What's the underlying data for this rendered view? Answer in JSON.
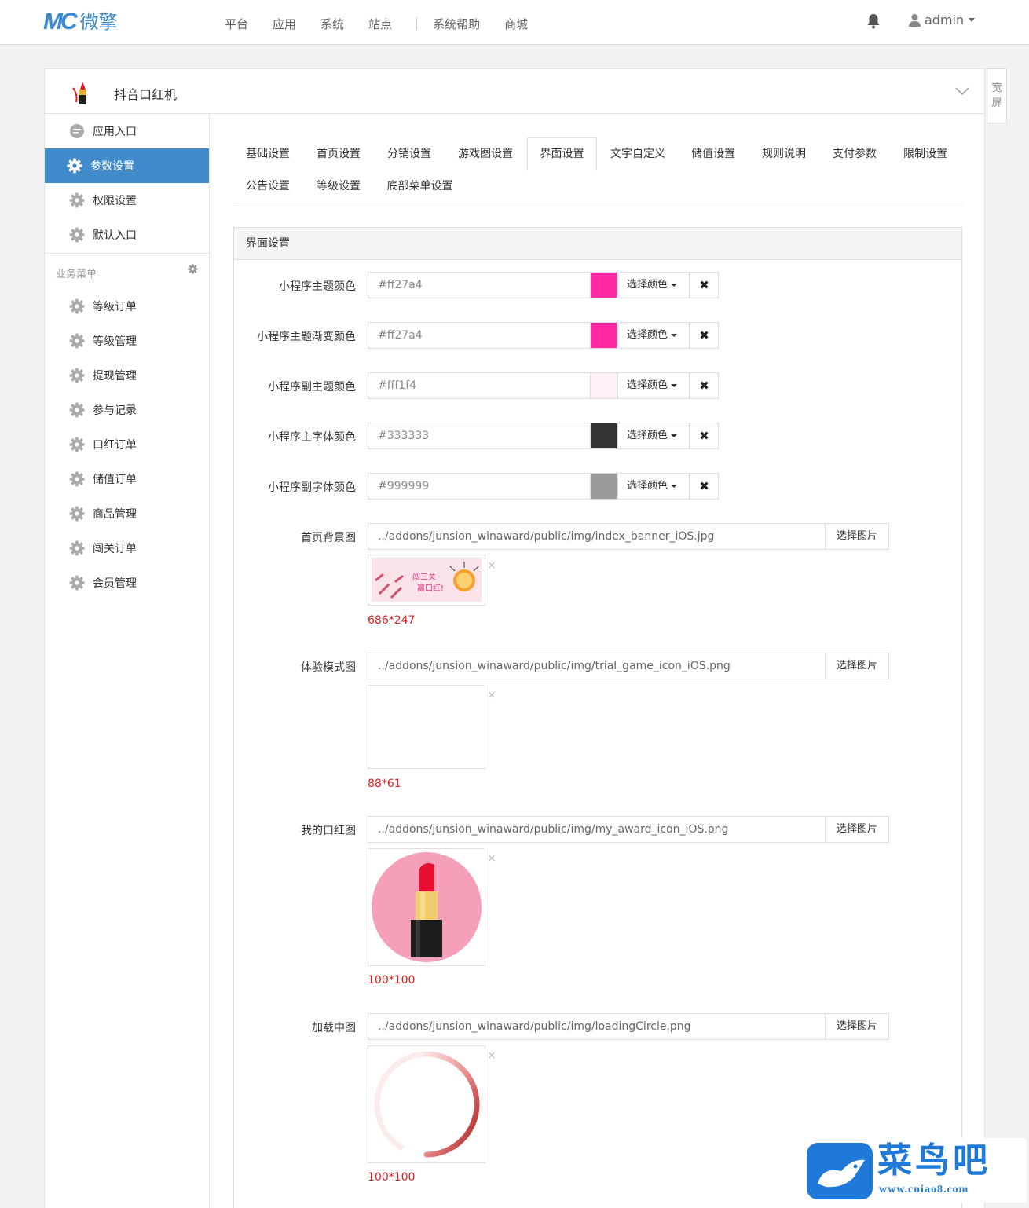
{
  "header": {
    "logo_mark": "MC",
    "logo_text": "微擎",
    "nav": [
      "平台",
      "应用",
      "系统",
      "站点",
      "系统帮助",
      "商城"
    ],
    "user": "admin"
  },
  "wide_toggle": "宽屏",
  "app": {
    "title": "抖音口红机"
  },
  "sidebar": {
    "top_items": [
      {
        "label": "应用入口",
        "icon": "chat-icon",
        "active": false
      },
      {
        "label": "参数设置",
        "icon": "gear-icon",
        "active": true
      },
      {
        "label": "权限设置",
        "icon": "gear-icon",
        "active": false
      },
      {
        "label": "默认入口",
        "icon": "gear-icon",
        "active": false
      }
    ],
    "section_title": "业务菜单",
    "business_items": [
      "等级订单",
      "等级管理",
      "提现管理",
      "参与记录",
      "口红订单",
      "储值订单",
      "商品管理",
      "闯关订单",
      "会员管理"
    ]
  },
  "tabs": {
    "row1": [
      "基础设置",
      "首页设置",
      "分销设置",
      "游戏图设置",
      "界面设置",
      "文字自定义",
      "储值设置",
      "规则说明",
      "支付参数",
      "限制设置"
    ],
    "row2": [
      "公告设置",
      "等级设置",
      "底部菜单设置"
    ],
    "active": "界面设置"
  },
  "form": {
    "title": "界面设置",
    "pick_color_label": "选择颜色",
    "clear_glyph": "✖",
    "colors": [
      {
        "label": "小程序主题颜色",
        "value": "#ff27a4",
        "swatch": "#ff27a4"
      },
      {
        "label": "小程序主题渐变颜色",
        "value": "#ff27a4",
        "swatch": "#ff27a4"
      },
      {
        "label": "小程序副主题颜色",
        "value": "#fff1f4",
        "swatch": "#fff1f4"
      },
      {
        "label": "小程序主字体颜色",
        "value": "#333333",
        "swatch": "#333333"
      },
      {
        "label": "小程序副字体颜色",
        "value": "#999999",
        "swatch": "#999999"
      }
    ],
    "select_image_label": "选择图片",
    "remove_glyph": "×",
    "images": [
      {
        "label": "首页背景图",
        "path": "../addons/junsion_winaward/public/img/index_banner_iOS.jpg",
        "size": "686*247",
        "banner_text_1": "闯三关",
        "banner_text_2": "赢口红!"
      },
      {
        "label": "体验模式图",
        "path": "../addons/junsion_winaward/public/img/trial_game_icon_iOS.png",
        "size": "88*61"
      },
      {
        "label": "我的口红图",
        "path": "../addons/junsion_winaward/public/img/my_award_icon_iOS.png",
        "size": "100*100"
      },
      {
        "label": "加载中图",
        "path": "../addons/junsion_winaward/public/img/loadingCircle.png",
        "size": "100*100"
      }
    ]
  },
  "watermark": {
    "text": "菜鸟吧",
    "url": "www.cniao8.com"
  }
}
